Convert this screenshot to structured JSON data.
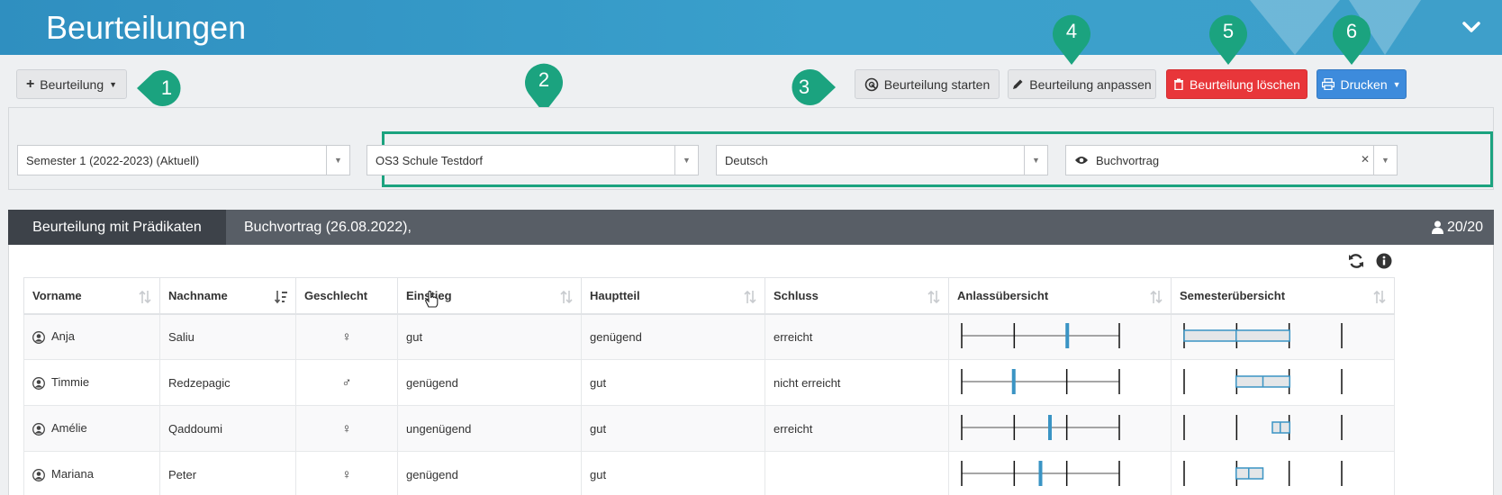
{
  "header": {
    "title": "Beurteilungen"
  },
  "toolbar": {
    "add_label": "Beurteilung",
    "start_label": "Beurteilung starten",
    "edit_label": "Beurteilung anpassen",
    "delete_label": "Beurteilung löschen",
    "print_label": "Drucken"
  },
  "callouts": [
    "1",
    "2",
    "3",
    "4",
    "5",
    "6"
  ],
  "filters": {
    "semester": "Semester 1 (2022-2023) (Aktuell)",
    "school": "OS3 Schule Testdorf",
    "subject": "Deutsch",
    "assessment": "Buchvortrag"
  },
  "section": {
    "tab_label": "Beurteilung mit Prädikaten",
    "subtitle": "Buchvortrag (26.08.2022),",
    "count": "20/20"
  },
  "table": {
    "headers": [
      "Vorname",
      "Nachname",
      "Geschlecht",
      "Einstieg",
      "Hauptteil",
      "Schluss",
      "Anlassübersicht",
      "Semesterübersicht"
    ],
    "rows": [
      {
        "vorname": "Anja",
        "nachname": "Saliu",
        "gender": "♀",
        "einstieg": "gut",
        "hauptteil": "genügend",
        "schluss": "erreicht",
        "anlass": 0.67,
        "sem_box": [
          0.0,
          0.67
        ],
        "sem_mid": 0.33
      },
      {
        "vorname": "Timmie",
        "nachname": "Redzepagic",
        "gender": "♂",
        "einstieg": "genügend",
        "hauptteil": "gut",
        "schluss": "nicht erreicht",
        "anlass": 0.33,
        "sem_box": [
          0.33,
          0.67
        ],
        "sem_mid": 0.5
      },
      {
        "vorname": "Amélie",
        "nachname": "Qaddoumi",
        "gender": "♀",
        "einstieg": "ungenügend",
        "hauptteil": "gut",
        "schluss": "erreicht",
        "anlass": 0.56,
        "sem_box": [
          0.56,
          0.67
        ],
        "sem_mid": 0.61
      },
      {
        "vorname": "Mariana",
        "nachname": "Peter",
        "gender": "♀",
        "einstieg": "genügend",
        "hauptteil": "gut",
        "schluss": "",
        "anlass": 0.5,
        "sem_box": [
          0.33,
          0.5
        ],
        "sem_mid": 0.41
      }
    ]
  },
  "colors": {
    "accent": "#3aa0cc",
    "callout": "#1ba37f",
    "danger": "#e8363a",
    "primary": "#3d8bdc",
    "marker": "#3a94c4"
  }
}
